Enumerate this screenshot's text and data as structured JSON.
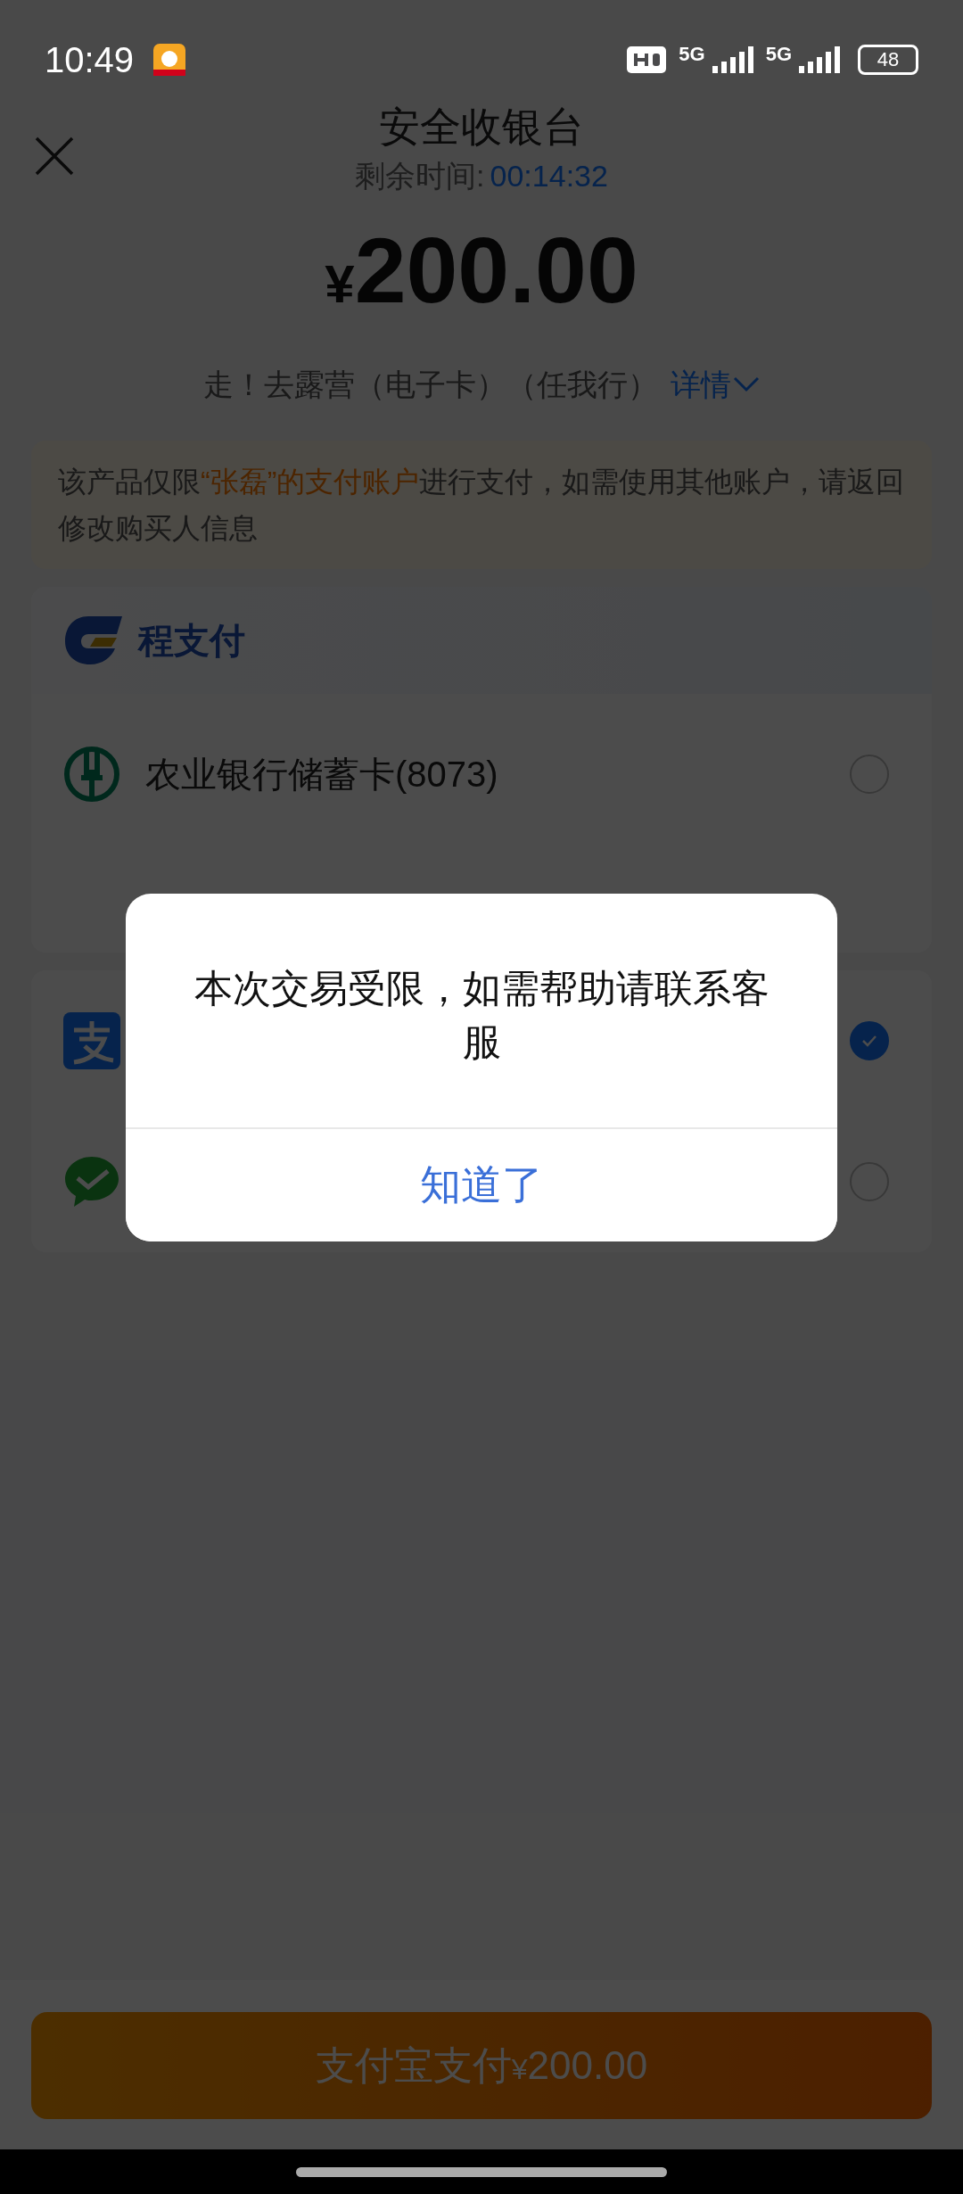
{
  "status_bar": {
    "time": "10:49",
    "network_types": [
      "5G",
      "5G"
    ],
    "battery": "48"
  },
  "header": {
    "title": "安全收银台",
    "timer_label": "剩余时间:",
    "timer": "00:14:32",
    "currency": "¥",
    "amount": "200.00",
    "description": "走！去露营（电子卡）（任我行）",
    "details_link": "详情"
  },
  "notice": {
    "parts": [
      {
        "text": "该产品仅限",
        "highlight": false
      },
      {
        "text": "“张磊”的支付账户",
        "highlight": true
      },
      {
        "text": "进行支付，如需使用其他账户，请返回修改购买人信息",
        "highlight": false
      }
    ]
  },
  "payment_groups": [
    {
      "brand": "程支付",
      "methods": [
        {
          "kind": "bank",
          "name": "农业银行储蓄卡(8073)",
          "selected": false
        }
      ]
    },
    {
      "methods": [
        {
          "kind": "alipay",
          "selected": true
        },
        {
          "kind": "wechat",
          "selected": false
        }
      ]
    }
  ],
  "dialog": {
    "message": "本次交易受限，如需帮助请联系客服",
    "button": "知道了"
  },
  "pay_button": {
    "label": "支付宝支付",
    "currency": "¥",
    "amount": "200.00"
  }
}
